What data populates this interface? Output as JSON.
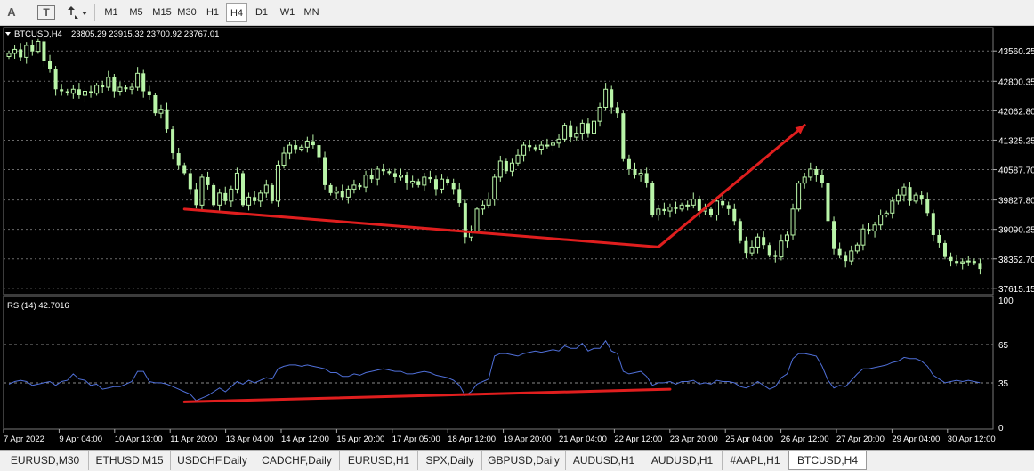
{
  "toolbar": {
    "text_tool": "A",
    "text_label_tool": "T",
    "timeframes": [
      "M1",
      "M5",
      "M15",
      "M30",
      "H1",
      "H4",
      "D1",
      "W1",
      "MN"
    ],
    "active_timeframe": "H4"
  },
  "chart": {
    "symbol_label": "BTCUSD,H4",
    "ohlc": "23805.29 23915.32 23700.92 23767.01",
    "price_ticks": [
      "43560.25",
      "42800.35",
      "42062.80",
      "41325.25",
      "40587.70",
      "39827.80",
      "39090.25",
      "38352.70",
      "37615.15"
    ],
    "rsi_label": "RSI(14) 42.7016",
    "rsi_ticks": [
      "100",
      "65",
      "35",
      "0"
    ],
    "time_labels": [
      "7 Apr 2022",
      "9 Apr 04:00",
      "10 Apr 13:00",
      "11 Apr 20:00",
      "13 Apr 04:00",
      "14 Apr 12:00",
      "15 Apr 20:00",
      "17 Apr 05:00",
      "18 Apr 12:00",
      "19 Apr 20:00",
      "21 Apr 04:00",
      "22 Apr 12:00",
      "23 Apr 20:00",
      "25 Apr 04:00",
      "26 Apr 12:00",
      "27 Apr 20:00",
      "29 Apr 04:00",
      "30 Apr 12:00"
    ],
    "colors": {
      "background": "#000000",
      "candle": "#b9f5a8",
      "grid": "#6a6a6a",
      "text": "#ffffff",
      "rsi": "#4f6fd8",
      "trendline": "#e01e1e"
    }
  },
  "chart_data": {
    "type": "candlestick",
    "title": "BTCUSD,H4",
    "ylim": [
      37500,
      44100
    ],
    "closes": [
      43500,
      43600,
      43400,
      43700,
      43550,
      43800,
      43300,
      43100,
      42600,
      42550,
      42500,
      42600,
      42450,
      42550,
      42500,
      42700,
      42650,
      42900,
      42550,
      42650,
      42600,
      42650,
      43000,
      42550,
      42450,
      42000,
      42100,
      41600,
      41000,
      40700,
      40500,
      40100,
      39700,
      40400,
      40200,
      39700,
      40000,
      39800,
      40100,
      40500,
      39700,
      39900,
      39800,
      40000,
      40200,
      39800,
      40700,
      41000,
      41200,
      41100,
      41150,
      41300,
      41200,
      40900,
      40200,
      40000,
      40050,
      39900,
      40100,
      40200,
      40150,
      40450,
      40350,
      40600,
      40550,
      40500,
      40400,
      40450,
      40250,
      40300,
      40200,
      40400,
      40350,
      40100,
      40350,
      40250,
      40100,
      39750,
      38900,
      39050,
      39600,
      39700,
      39850,
      40400,
      40800,
      40550,
      40750,
      40950,
      41200,
      41150,
      41100,
      41200,
      41200,
      41250,
      41350,
      41700,
      41400,
      41500,
      41750,
      41500,
      41800,
      42150,
      42600,
      42150,
      42000,
      40850,
      40600,
      40450,
      40500,
      40250,
      39450,
      39600,
      39550,
      39650,
      39600,
      39700,
      39700,
      39850,
      39550,
      39600,
      39450,
      39800,
      39700,
      39600,
      39300,
      38800,
      38500,
      38650,
      38900,
      38700,
      38450,
      38400,
      38800,
      38950,
      39600,
      40250,
      40400,
      40600,
      40450,
      40250,
      39300,
      38600,
      38450,
      38300,
      38550,
      38700,
      39100,
      39050,
      39200,
      39450,
      39500,
      39800,
      39950,
      40150,
      39800,
      39950,
      39850,
      39500,
      38950,
      38750,
      38400,
      38300,
      38250,
      38280,
      38300,
      38250,
      38100
    ],
    "rsi": [
      34,
      36,
      37,
      36,
      33,
      34,
      35,
      36,
      33,
      36,
      37,
      42,
      38,
      37,
      33,
      34,
      30,
      31,
      32,
      32,
      34,
      36,
      44,
      44,
      36,
      35,
      35,
      34,
      32,
      30,
      28,
      26,
      21,
      23,
      25,
      28,
      31,
      28,
      32,
      36,
      34,
      37,
      35,
      37,
      39,
      38,
      46,
      48,
      49,
      49,
      48,
      49,
      48,
      47,
      46,
      43,
      43,
      40,
      40,
      42,
      41,
      43,
      44,
      45,
      46,
      45,
      44,
      44,
      42,
      42,
      43,
      44,
      43,
      41,
      40,
      39,
      37,
      33,
      25,
      28,
      34,
      36,
      38,
      56,
      58,
      58,
      57,
      56,
      58,
      59,
      60,
      59,
      60,
      61,
      60,
      64,
      62,
      62,
      66,
      60,
      62,
      62,
      68,
      60,
      58,
      44,
      42,
      43,
      44,
      40,
      33,
      35,
      35,
      36,
      34,
      36,
      36,
      37,
      34,
      35,
      34,
      37,
      36,
      36,
      35,
      32,
      31,
      33,
      36,
      33,
      30,
      32,
      39,
      42,
      54,
      58,
      58,
      57,
      56,
      48,
      37,
      31,
      33,
      32,
      37,
      42,
      46,
      46,
      47,
      48,
      49,
      51,
      52,
      55,
      54,
      54,
      52,
      48,
      41,
      38,
      35,
      36,
      37,
      36,
      37,
      36,
      35
    ],
    "annotations": [
      {
        "pane": "price",
        "points": [
          [
            30,
            39600
          ],
          [
            111,
            38650
          ]
        ]
      },
      {
        "pane": "price",
        "points": [
          [
            111,
            38650
          ],
          [
            136,
            41700
          ]
        ],
        "arrow": true
      },
      {
        "pane": "rsi",
        "points": [
          [
            30,
            20
          ],
          [
            113,
            30
          ]
        ]
      }
    ]
  },
  "tabs": [
    "EURUSD,M30",
    "ETHUSD,M15",
    "USDCHF,Daily",
    "CADCHF,Daily",
    "EURUSD,H1",
    "SPX,Daily",
    "GBPUSD,Daily",
    "AUDUSD,H1",
    "AUDUSD,H1",
    "#AAPL,H1",
    "BTCUSD,H4"
  ],
  "active_tab": "BTCUSD,H4"
}
